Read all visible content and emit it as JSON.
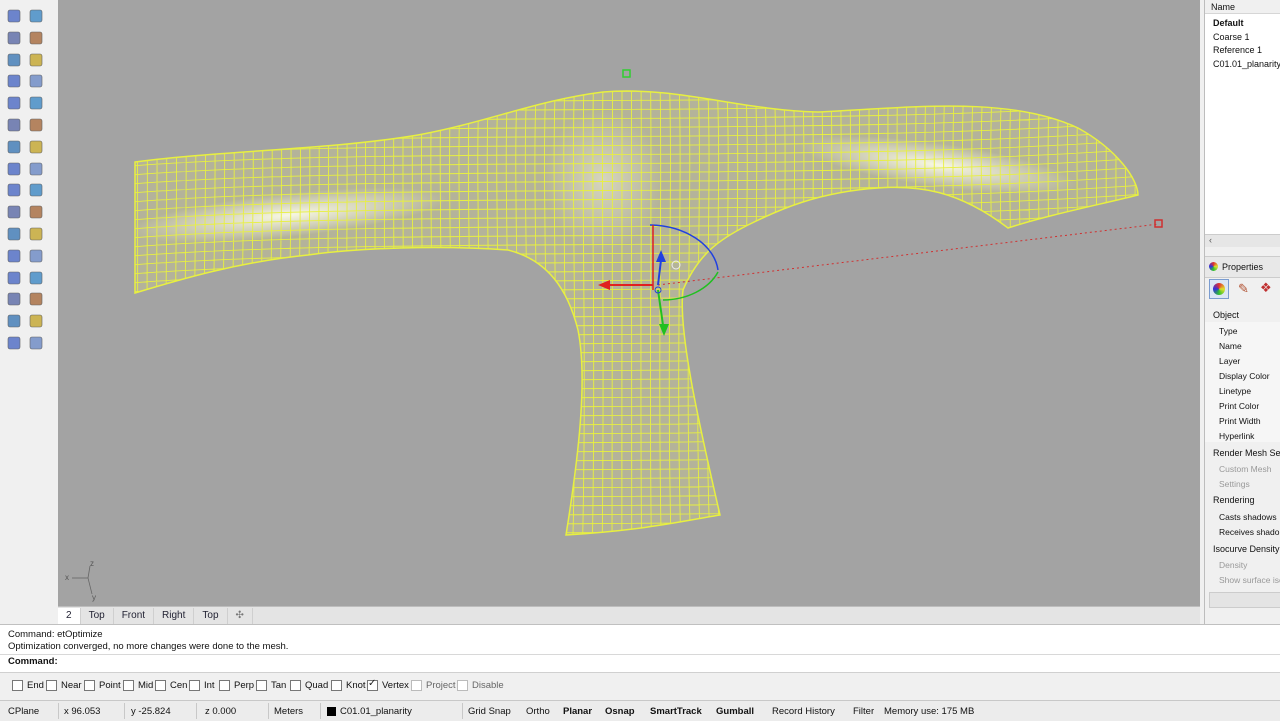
{
  "layers_panel": {
    "header": "Name",
    "items": [
      "Default",
      "Coarse 1",
      "Reference 1",
      "C01.01_planarity"
    ]
  },
  "properties_panel": {
    "title": "Properties",
    "section_object": "Object",
    "fields": [
      "Type",
      "Name",
      "Layer",
      "Display Color",
      "Linetype",
      "Print Color",
      "Print Width",
      "Hyperlink"
    ],
    "section_render_mesh": "Render Mesh Setti",
    "render_mesh_fields": [
      "Custom Mesh",
      "Settings"
    ],
    "section_rendering": "Rendering",
    "rendering_fields": [
      "Casts shadows",
      "Receives shado"
    ],
    "section_isocurve": "Isocurve Density",
    "isocurve_fields": [
      "Density",
      "Show surface isc"
    ]
  },
  "viewport_tabs": [
    "2",
    "Top",
    "Front",
    "Right",
    "Top"
  ],
  "command": {
    "line1": "Command: etOptimize",
    "line2": "Optimization converged, no more changes were done to the mesh.",
    "prompt": "Command:"
  },
  "osnaps": [
    {
      "label": "End",
      "checked": false
    },
    {
      "label": "Near",
      "checked": false
    },
    {
      "label": "Point",
      "checked": false
    },
    {
      "label": "Mid",
      "checked": false
    },
    {
      "label": "Cen",
      "checked": false
    },
    {
      "label": "Int",
      "checked": false
    },
    {
      "label": "Perp",
      "checked": false
    },
    {
      "label": "Tan",
      "checked": false
    },
    {
      "label": "Quad",
      "checked": false
    },
    {
      "label": "Knot",
      "checked": false
    },
    {
      "label": "Vertex",
      "checked": true
    },
    {
      "label": "Project",
      "checked": false
    },
    {
      "label": "Disable",
      "checked": false
    }
  ],
  "status": {
    "cplane": "CPlane",
    "x": "x 96.053",
    "y": "y -25.824",
    "z": "z 0.000",
    "units": "Meters",
    "layer": "C01.01_planarity",
    "grid_snap": "Grid Snap",
    "ortho": "Ortho",
    "planar": "Planar",
    "osnap": "Osnap",
    "smarttrack": "SmartTrack",
    "gumball": "Gumball",
    "record_history": "Record History",
    "filter": "Filter",
    "memory": "Memory use: 175 MB"
  },
  "colors": {
    "viewport_bg": "#a3a3a3",
    "mesh_wire": "#e8f040",
    "mesh_highlight": "#f4f4d8",
    "gumball_x": "#e02020",
    "gumball_y": "#20c020",
    "gumball_z": "#2040e0"
  },
  "axis_labels": {
    "x": "x",
    "y": "y",
    "z": "z"
  }
}
